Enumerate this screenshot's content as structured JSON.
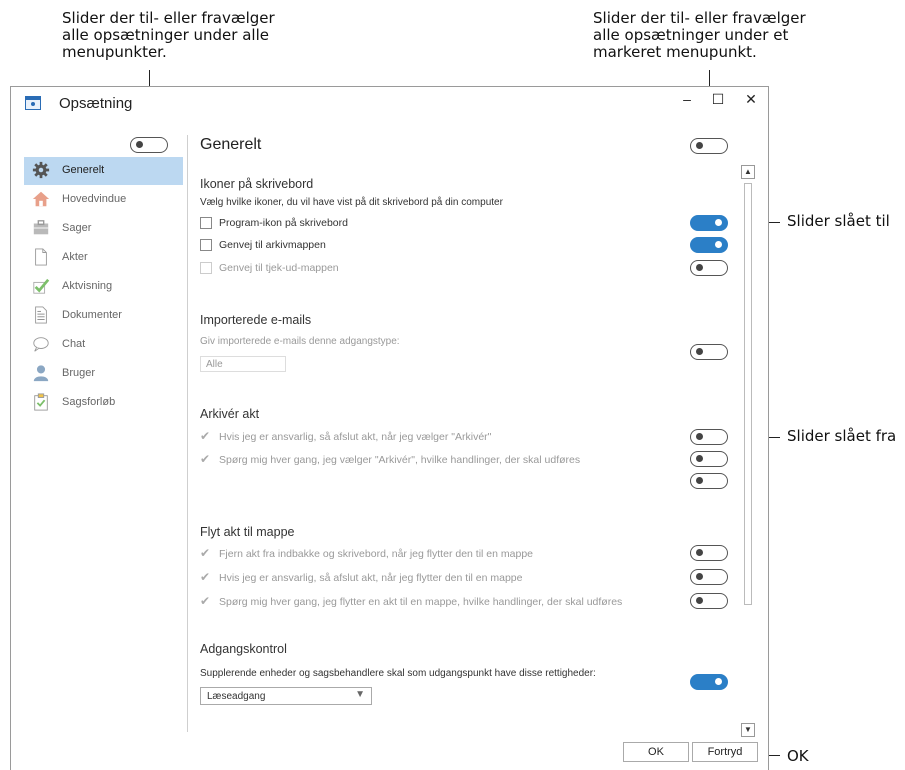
{
  "callouts": {
    "top_left": "Slider der til- eller fravælger\nalle opsætninger under alle\nmenupunkter.",
    "top_right": "Slider der til- eller fravælger\nalle opsætninger under et\nmarkeret menupunkt.",
    "slider_on": "Slider slået til",
    "slider_off": "Slider slået fra",
    "ok": "OK"
  },
  "window": {
    "title": "Opsætning",
    "minimize": "–",
    "maximize": "☐",
    "close": "✕"
  },
  "sidebar": {
    "master_toggle": false,
    "items": [
      {
        "label": "Generelt",
        "icon": "gear-icon",
        "active": true
      },
      {
        "label": "Hovedvindue",
        "icon": "home-icon"
      },
      {
        "label": "Sager",
        "icon": "briefcase-icon"
      },
      {
        "label": "Akter",
        "icon": "document-icon"
      },
      {
        "label": "Aktvisning",
        "icon": "checkmark-icon"
      },
      {
        "label": "Dokumenter",
        "icon": "text-document-icon"
      },
      {
        "label": "Chat",
        "icon": "chat-bubble-icon"
      },
      {
        "label": "Bruger",
        "icon": "user-icon"
      },
      {
        "label": "Sagsforløb",
        "icon": "clipboard-icon"
      }
    ]
  },
  "main": {
    "title": "Generelt",
    "section_toggle": false,
    "sections": {
      "ikoner": {
        "title": "Ikoner på skrivebord",
        "description": "Vælg hvilke ikoner, du vil have vist på dit skrivebord på din computer",
        "items": [
          {
            "label": "Program-ikon på skrivebord",
            "checked": false,
            "enabled": true,
            "toggle": true
          },
          {
            "label": "Genvej til arkivmappen",
            "checked": false,
            "enabled": true,
            "toggle": true
          },
          {
            "label": "Genvej til tjek-ud-mappen",
            "checked": false,
            "enabled": false,
            "toggle": false
          }
        ]
      },
      "importerede": {
        "title": "Importerede e-mails",
        "description": "Giv importerede e-mails denne adgangstype:",
        "value": "Alle",
        "toggle": false
      },
      "arkiver": {
        "title": "Arkivér akt",
        "items": [
          {
            "label": "Hvis jeg er ansvarlig, så afslut akt, når jeg vælger \"Arkivér\"",
            "checked": true,
            "enabled": false,
            "toggle": false
          },
          {
            "label": "Spørg mig hver gang, jeg vælger \"Arkivér\", hvilke handlinger, der skal udføres",
            "checked": true,
            "enabled": false,
            "toggle": false
          }
        ],
        "extra_toggle": false
      },
      "flyt": {
        "title": "Flyt akt til mappe",
        "items": [
          {
            "label": "Fjern akt fra indbakke og skrivebord, når jeg flytter den til en mappe",
            "checked": true,
            "enabled": false,
            "toggle": false
          },
          {
            "label": "Hvis jeg er ansvarlig, så afslut akt, når jeg flytter den til en mappe",
            "checked": true,
            "enabled": false,
            "toggle": false
          },
          {
            "label": "Spørg mig hver gang, jeg flytter en akt til en mappe, hvilke handlinger, der skal udføres",
            "checked": true,
            "enabled": false,
            "toggle": false
          }
        ]
      },
      "adgang": {
        "title": "Adgangskontrol",
        "description": "Supplerende enheder og sagsbehandlere skal som udgangspunkt have disse rettigheder:",
        "value": "Læseadgang",
        "toggle": true
      }
    }
  },
  "buttons": {
    "ok": "OK",
    "cancel": "Fortryd"
  },
  "colors": {
    "accent": "#2b7fc7",
    "sidebar_active": "#bcd8f1"
  }
}
